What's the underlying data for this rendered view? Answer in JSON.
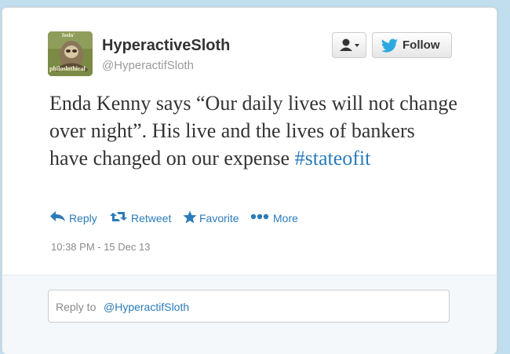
{
  "tweet": {
    "display_name": "HyperactiveSloth",
    "screen_name": "@HyperactifSloth",
    "text_main": "Enda Kenny says “Our daily lives will not change over night”. His live and the lives of bankers have changed on our expense",
    "hashtag": "#stateofit",
    "timestamp": "10:38 PM - 15 Dec 13"
  },
  "avatar": {
    "text_top": "feeln'",
    "text_bottom": "philoslothical"
  },
  "buttons": {
    "follow_label": "Follow",
    "user_dropdown_icon": "user-icon"
  },
  "actions": {
    "reply_label": "Reply",
    "retweet_label": "Retweet",
    "favorite_label": "Favorite",
    "more_label": "More"
  },
  "reply_box": {
    "prefix": "Reply to",
    "mention": "@HyperactifSloth"
  },
  "colors": {
    "background": "#c0deed",
    "link": "#2b7bb9",
    "text": "#333333",
    "muted": "#999999"
  }
}
